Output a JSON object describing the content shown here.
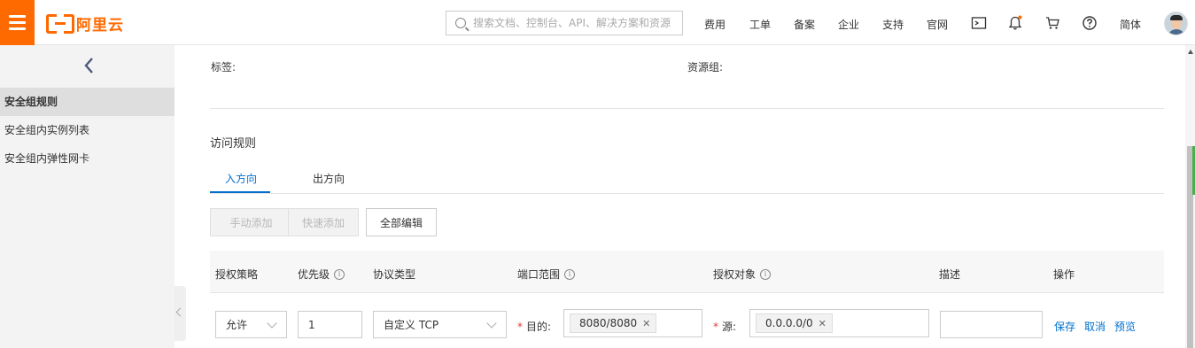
{
  "header": {
    "logo_text": "阿里云",
    "search_placeholder": "搜索文档、控制台、API、解决方案和资源",
    "nav": [
      "费用",
      "工单",
      "备案",
      "企业",
      "支持",
      "官网"
    ],
    "language": "简体"
  },
  "sidebar": {
    "items": [
      {
        "label": "安全组规则",
        "active": true
      },
      {
        "label": "安全组内实例列表",
        "active": false
      },
      {
        "label": "安全组内弹性网卡",
        "active": false
      }
    ]
  },
  "info": {
    "tags_label": "标签:",
    "resource_group_label": "资源组:"
  },
  "rules": {
    "title": "访问规则",
    "tabs": [
      {
        "label": "入方向",
        "active": true
      },
      {
        "label": "出方向",
        "active": false
      }
    ],
    "buttons": {
      "manual_add": "手动添加",
      "quick_add": "快速添加",
      "edit_all": "全部编辑"
    },
    "columns": [
      "授权策略",
      "优先级",
      "协议类型",
      "端口范围",
      "授权对象",
      "描述",
      "操作"
    ],
    "row": {
      "policy": "允许",
      "priority": "1",
      "protocol": "自定义 TCP",
      "dest_label": "目的:",
      "dest_tag": "8080/8080",
      "source_label": "源:",
      "source_tag": "0.0.0.0/0",
      "description": "",
      "actions": [
        "保存",
        "取消",
        "预览"
      ]
    }
  },
  "colors": {
    "brand": "#ff6a00",
    "link": "#0070cc",
    "required": "#e53935"
  }
}
